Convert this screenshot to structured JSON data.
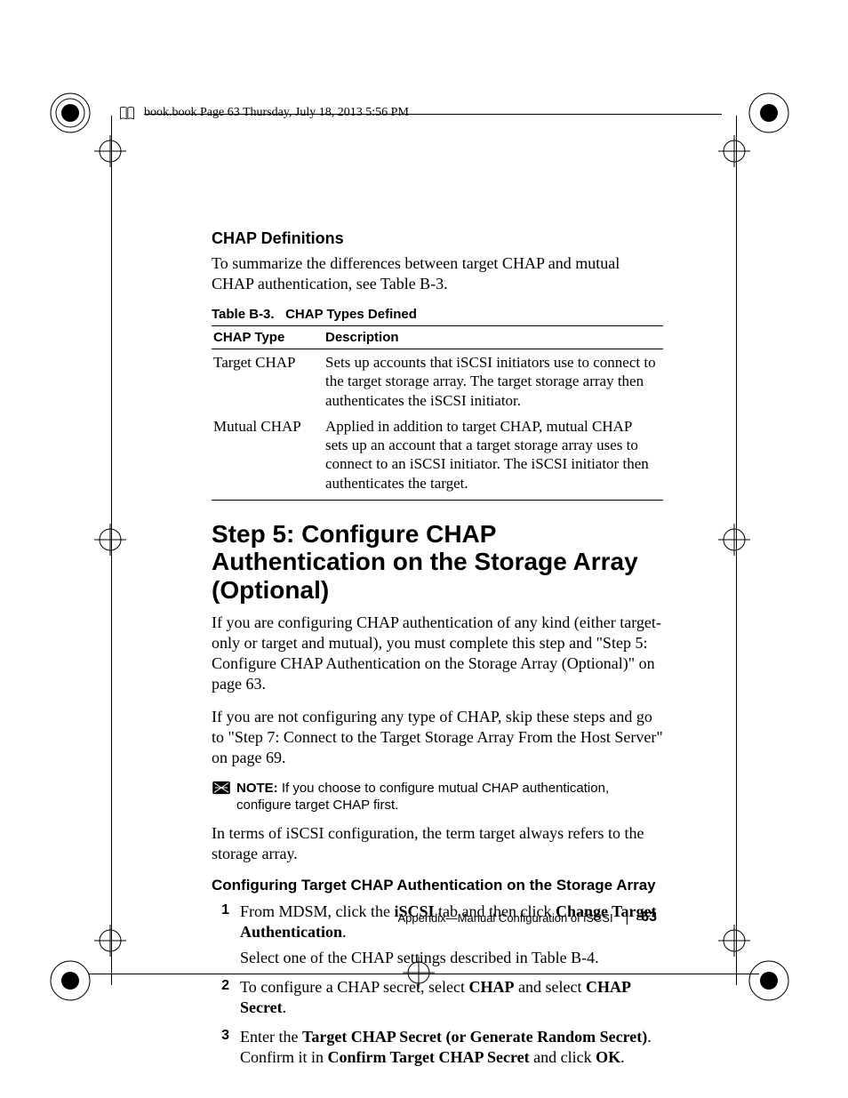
{
  "header": {
    "text": "book.book  Page 63  Thursday, July 18, 2013  5:56 PM"
  },
  "section1": {
    "heading": "CHAP Definitions",
    "para": "To summarize the differences between target CHAP and mutual CHAP authentication, see Table B-3."
  },
  "table": {
    "caption_prefix": "Table B-3.",
    "caption_title": "CHAP Types Defined",
    "col1": "CHAP Type",
    "col2": "Description",
    "rows": [
      {
        "type": "Target CHAP",
        "desc": "Sets up accounts that iSCSI initiators use to connect to the target storage array. The target storage array then authenticates the iSCSI initiator."
      },
      {
        "type": "Mutual CHAP",
        "desc": "Applied in addition to target CHAP, mutual CHAP sets up an account that a target storage array uses to connect to an iSCSI initiator. The iSCSI initiator then authenticates the target."
      }
    ]
  },
  "step5": {
    "heading": "Step 5: Configure CHAP Authentication on the Storage Array (Optional)",
    "para1": "If you are configuring CHAP authentication of any kind (either target-only or target and mutual), you must complete this step and \"Step 5: Configure CHAP Authentication on the Storage Array (Optional)\" on page 63.",
    "para2": "If you are not configuring any type of CHAP, skip these steps and go to \"Step 7: Connect to the Target Storage Array From the Host Server\" on page 69.",
    "note_label": "NOTE:",
    "note_text": " If you choose to configure mutual CHAP authentication, configure target CHAP first.",
    "para3": "In terms of iSCSI configuration, the term target always refers to the storage array."
  },
  "config_heading": "Configuring Target CHAP Authentication on the Storage Array",
  "steps": {
    "s1_pre": "From MDSM, click the ",
    "s1_b1": "iSCSI",
    "s1_mid": " tab and then click ",
    "s1_b2": "Change Target Authentication",
    "s1_post": ".",
    "s1_line2": "Select one of the CHAP settings described in Table B-4.",
    "s2_pre": "To configure a CHAP secret, select ",
    "s2_b1": "CHAP",
    "s2_mid": " and select ",
    "s2_b2": "CHAP Secret",
    "s2_post": ".",
    "s3_pre": "Enter the ",
    "s3_b1": "Target CHAP Secret (or Generate Random Secret)",
    "s3_mid": ". Confirm it in ",
    "s3_b2": "Confirm Target CHAP Secret",
    "s3_mid2": " and click ",
    "s3_b3": "OK",
    "s3_post": "."
  },
  "footer": {
    "appendix": "Appendix—Manual Configuration of iSCSI",
    "sep": "|",
    "page": "63"
  }
}
